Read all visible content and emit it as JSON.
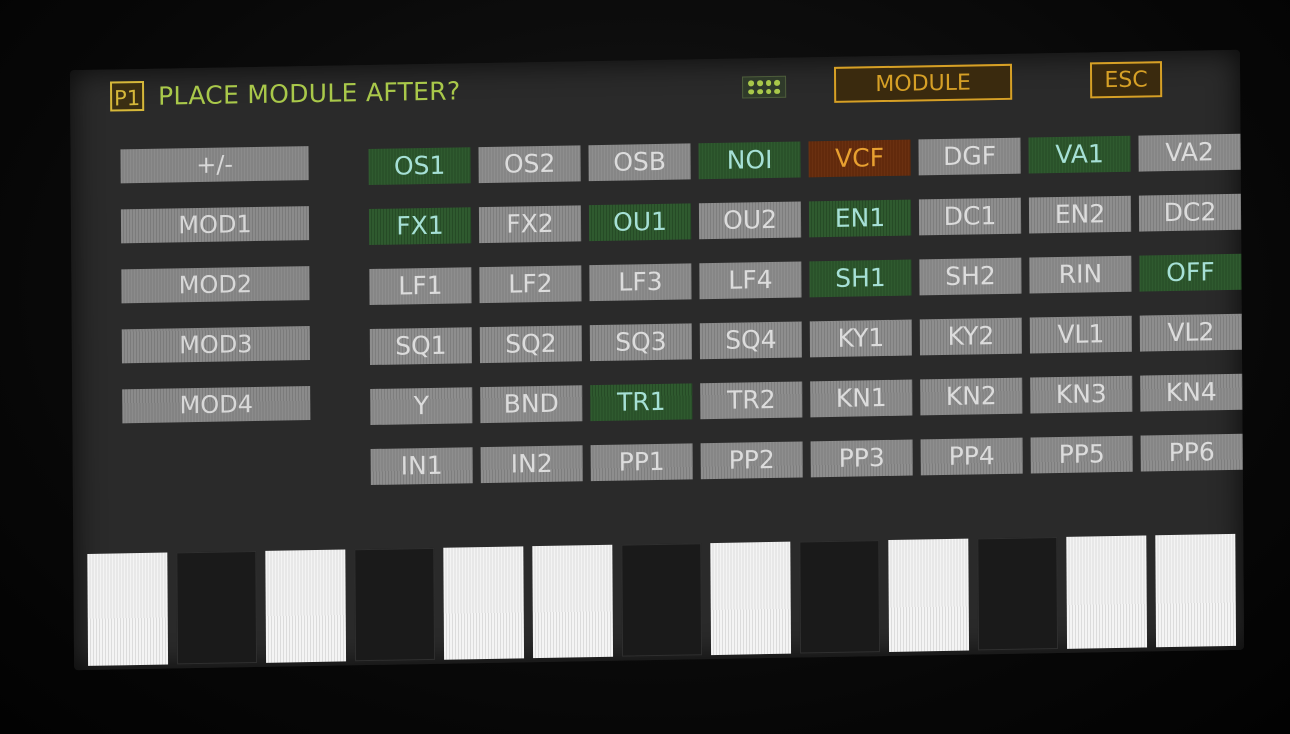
{
  "header": {
    "page_badge": "P1",
    "title": "PLACE MODULE AFTER?",
    "grip_icon": "grip-dots-icon",
    "module_label": "MODULE",
    "esc_label": "ESC"
  },
  "side_buttons": [
    "+/-",
    "MOD1",
    "MOD2",
    "MOD3",
    "MOD4"
  ],
  "grid": [
    [
      {
        "label": "OS1",
        "state": "green"
      },
      {
        "label": "OS2",
        "state": "gray"
      },
      {
        "label": "OSB",
        "state": "gray"
      },
      {
        "label": "NOI",
        "state": "green"
      },
      {
        "label": "VCF",
        "state": "orange"
      },
      {
        "label": "DGF",
        "state": "gray"
      },
      {
        "label": "VA1",
        "state": "green"
      },
      {
        "label": "VA2",
        "state": "gray"
      }
    ],
    [
      {
        "label": "FX1",
        "state": "green"
      },
      {
        "label": "FX2",
        "state": "gray"
      },
      {
        "label": "OU1",
        "state": "green"
      },
      {
        "label": "OU2",
        "state": "gray"
      },
      {
        "label": "EN1",
        "state": "green"
      },
      {
        "label": "DC1",
        "state": "gray"
      },
      {
        "label": "EN2",
        "state": "gray"
      },
      {
        "label": "DC2",
        "state": "gray"
      }
    ],
    [
      {
        "label": "LF1",
        "state": "gray"
      },
      {
        "label": "LF2",
        "state": "gray"
      },
      {
        "label": "LF3",
        "state": "gray"
      },
      {
        "label": "LF4",
        "state": "gray"
      },
      {
        "label": "SH1",
        "state": "green"
      },
      {
        "label": "SH2",
        "state": "gray"
      },
      {
        "label": "RIN",
        "state": "gray"
      },
      {
        "label": "OFF",
        "state": "green"
      }
    ],
    [
      {
        "label": "SQ1",
        "state": "gray"
      },
      {
        "label": "SQ2",
        "state": "gray"
      },
      {
        "label": "SQ3",
        "state": "gray"
      },
      {
        "label": "SQ4",
        "state": "gray"
      },
      {
        "label": "KY1",
        "state": "gray"
      },
      {
        "label": "KY2",
        "state": "gray"
      },
      {
        "label": "VL1",
        "state": "gray"
      },
      {
        "label": "VL2",
        "state": "gray"
      }
    ],
    [
      {
        "label": "Y",
        "state": "gray"
      },
      {
        "label": "BND",
        "state": "gray"
      },
      {
        "label": "TR1",
        "state": "green"
      },
      {
        "label": "TR2",
        "state": "gray"
      },
      {
        "label": "KN1",
        "state": "gray"
      },
      {
        "label": "KN2",
        "state": "gray"
      },
      {
        "label": "KN3",
        "state": "gray"
      },
      {
        "label": "KN4",
        "state": "gray"
      }
    ],
    [
      {
        "label": "IN1",
        "state": "gray"
      },
      {
        "label": "IN2",
        "state": "gray"
      },
      {
        "label": "PP1",
        "state": "gray"
      },
      {
        "label": "PP2",
        "state": "gray"
      },
      {
        "label": "PP3",
        "state": "gray"
      },
      {
        "label": "PP4",
        "state": "gray"
      },
      {
        "label": "PP5",
        "state": "gray"
      },
      {
        "label": "PP6",
        "state": "gray"
      }
    ]
  ],
  "keys": [
    "white",
    "black",
    "white",
    "black",
    "white",
    "white",
    "black",
    "white",
    "black",
    "white",
    "black",
    "white",
    "white"
  ],
  "colors": {
    "accent_yellow": "#d6b83a",
    "accent_orange": "#d6a026",
    "title_green": "#a9c84a",
    "cell_green": "#2f5a2f",
    "cell_orange": "#6a3010",
    "cell_gray": "#8e8e8e"
  }
}
